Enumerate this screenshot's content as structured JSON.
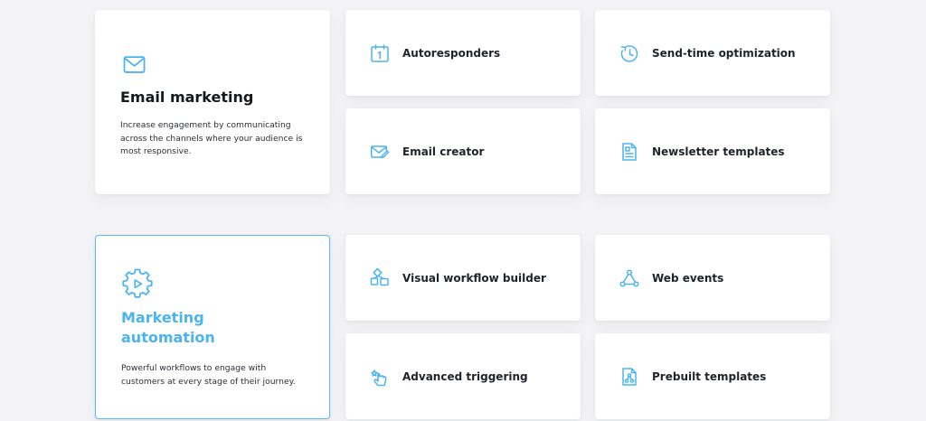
{
  "sections": [
    {
      "title": "Email marketing",
      "description": "Increase engagement by communicating across the channels where your audience is most responsive.",
      "icon": "envelope-icon",
      "active": false,
      "items": [
        {
          "label": "Autoresponders",
          "icon": "calendar-icon"
        },
        {
          "label": "Send-time optimization",
          "icon": "clock-icon"
        },
        {
          "label": "Email creator",
          "icon": "email-edit-icon"
        },
        {
          "label": "Newsletter templates",
          "icon": "document-template-icon"
        }
      ]
    },
    {
      "title": "Marketing automation",
      "description": "Powerful workflows to engage with customers at every stage of their journey.",
      "icon": "gear-play-icon",
      "active": true,
      "items": [
        {
          "label": "Visual workflow builder",
          "icon": "workflow-icon"
        },
        {
          "label": "Web events",
          "icon": "nodes-icon"
        },
        {
          "label": "Advanced triggering",
          "icon": "pointer-click-icon"
        },
        {
          "label": "Prebuilt templates",
          "icon": "document-flow-icon"
        }
      ]
    }
  ],
  "colors": {
    "accent": "#4cb3f1",
    "background": "#f4f4f6",
    "card": "#ffffff",
    "text": "#1f2329"
  }
}
